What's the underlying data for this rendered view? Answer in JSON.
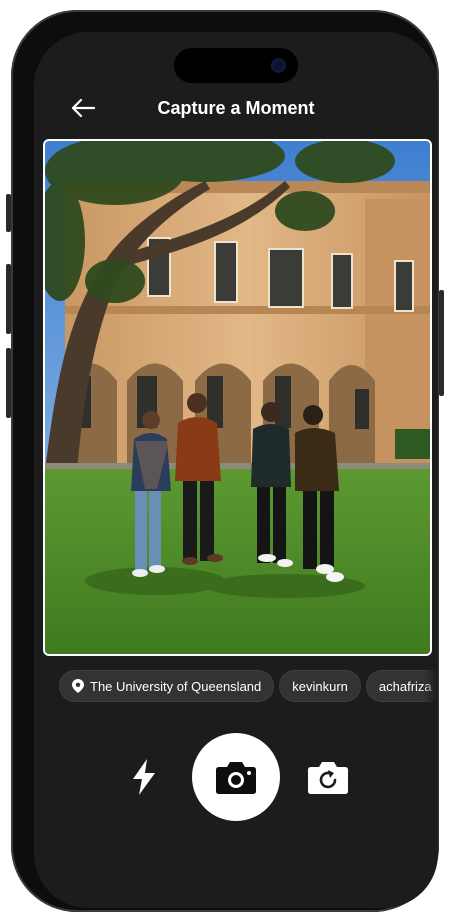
{
  "header": {
    "title": "Capture a Moment",
    "back_icon": "arrow-left-icon"
  },
  "photo": {
    "description_icon": "photo-preview",
    "sky_color": "#6fa0d3",
    "grass_color": "#4f8a2a",
    "building_color": "#d9ae7c"
  },
  "tags": [
    {
      "label": "The University of Queensland",
      "icon": "location-pin-icon"
    },
    {
      "label": "kevinkurn"
    },
    {
      "label": "achafriza"
    }
  ],
  "controls": {
    "flash_icon": "flash-icon",
    "shutter_icon": "camera-icon",
    "flip_icon": "switch-camera-icon"
  },
  "colors": {
    "screen_bg": "#1c1c1c",
    "chip_bg": "#333333",
    "shutter_bg": "#ffffff"
  }
}
